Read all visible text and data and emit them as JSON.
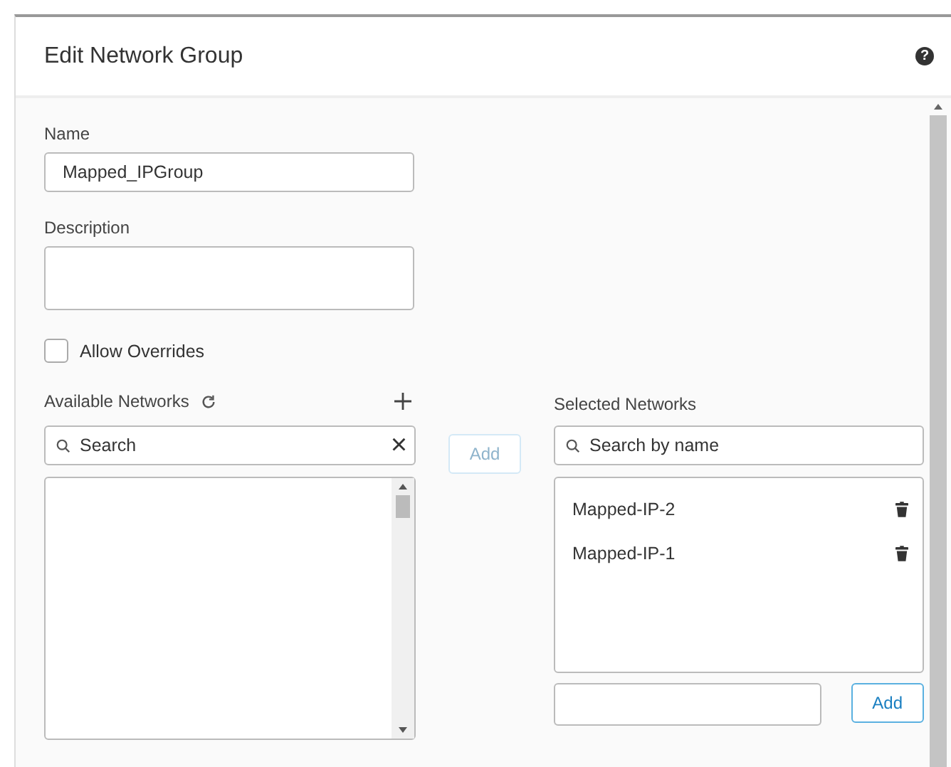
{
  "window": {
    "title": "Edit Network Group",
    "help_label": "?"
  },
  "name": {
    "label": "Name",
    "value": "Mapped_IPGroup"
  },
  "description": {
    "label": "Description"
  },
  "allow_overrides": {
    "label": "Allow Overrides",
    "checked": false
  },
  "available": {
    "title": "Available Networks",
    "search_placeholder": "Search",
    "clear_icon": "×"
  },
  "add_button": {
    "label": "Add",
    "disabled": true
  },
  "selected": {
    "title": "Selected Networks",
    "search_placeholder": "Search by name",
    "items": [
      {
        "name": "Mapped-IP-2"
      },
      {
        "name": "Mapped-IP-1"
      }
    ],
    "add_button": {
      "label": "Add",
      "disabled": false
    }
  }
}
